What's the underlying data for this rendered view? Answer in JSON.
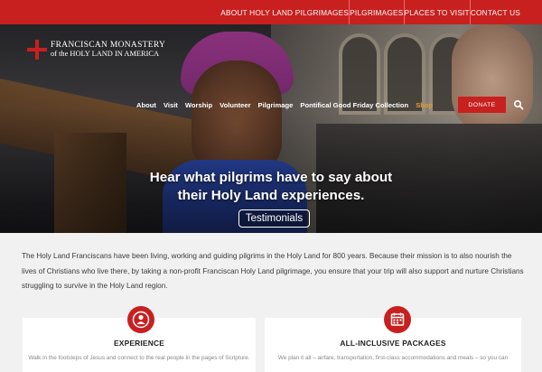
{
  "topbar": {
    "links": [
      "ABOUT HOLY LAND PILGRIMAGES",
      "PILGRIMAGES",
      "PLACES TO VISIT",
      "CONTACT US"
    ]
  },
  "logo": {
    "line1": "FRANCISCAN MONASTERY",
    "line2": "of the HOLY LAND IN AMERICA",
    "icon": "jerusalem-cross-icon"
  },
  "nav": {
    "items": [
      "About",
      "Visit",
      "Worship",
      "Volunteer",
      "Pilgrimage",
      "Pontifical Good Friday Collection",
      "Shop"
    ],
    "donate_label": "DONATE",
    "search_icon": "search-icon"
  },
  "hero": {
    "headline_line1": "Hear what pilgrims have to say about",
    "headline_line2": "their Holy Land experiences.",
    "button_label": "Testimonials"
  },
  "intro": {
    "text": "The Holy Land Franciscans have been living, working and guiding pilgrims in the Holy Land for 800 years. Because their mission is to also nourish the lives of Christians who live there, by taking a non-profit Franciscan Holy Land pilgrimage, you ensure that your trip will also support and nurture Christians struggling to survive in the Holy Land region."
  },
  "cards": [
    {
      "icon": "person-icon",
      "title": "EXPERIENCE",
      "body": "Walk in the footsteps of Jesus and connect to the real people in the pages of Scripture."
    },
    {
      "icon": "calendar-icon",
      "title": "ALL-INCLUSIVE PACKAGES",
      "body": "We plan it all – airfare, transportation, first-class accommodations and meals – so you can"
    }
  ],
  "colors": {
    "brand_red": "#c8201f",
    "shop_orange": "#e39a2d"
  }
}
